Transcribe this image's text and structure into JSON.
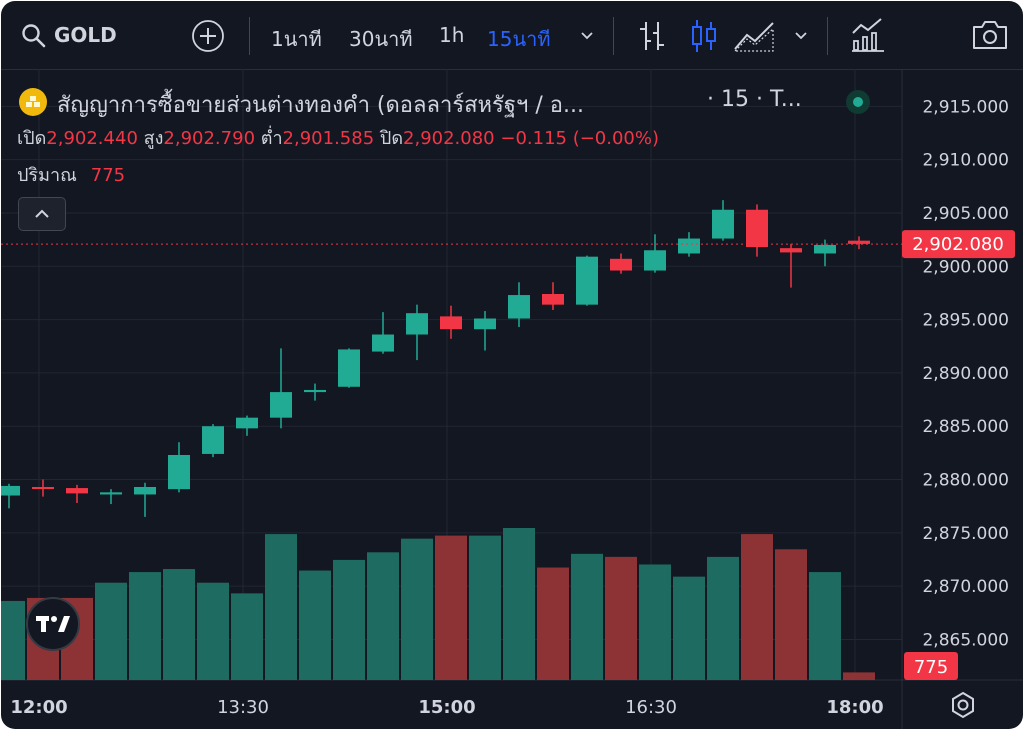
{
  "toolbar": {
    "symbol": "GOLD",
    "intervals": [
      "1นาที",
      "30นาที",
      "1h",
      "15นาที"
    ],
    "active_interval": "15นาที"
  },
  "legend": {
    "title": "สัญญาการซื้อขายส่วนต่างทองคำ (ดอลลาร์สหรัฐฯ / อ...",
    "interval": "· 15 · T...",
    "open_label": "เปิด",
    "open": "2,902.440",
    "high_label": "สูง",
    "high": "2,902.790",
    "low_label": "ต่ำ",
    "low": "2,901.585",
    "close_label": "ปิด",
    "close": "2,902.080",
    "change": "−0.115 (−0.00%)",
    "volume_label": "ปริมาณ",
    "volume": "775"
  },
  "colors": {
    "up": "#22ab94",
    "down": "#f23645",
    "vol_up": "#1e6b62",
    "vol_down": "#8d3335",
    "background": "#131722"
  },
  "chart_data": {
    "type": "candlestick",
    "x_ticks": [
      "12:00",
      "13:30",
      "15:00",
      "16:30",
      "18:00"
    ],
    "y_ticks": [
      "2,915.000",
      "2,910.000",
      "2,905.000",
      "2,900.000",
      "2,895.000",
      "2,890.000",
      "2,885.000",
      "2,880.000",
      "2,875.000",
      "2,870.000",
      "2,865.000"
    ],
    "ylim": [
      2861.2,
      2918.5
    ],
    "last_price": 2902.08,
    "last_price_label": "2,902.080",
    "volume_label": "775",
    "candles": [
      {
        "o": 2878.5,
        "h": 2879.6,
        "l": 2877.3,
        "c": 2879.4
      },
      {
        "o": 2879.3,
        "h": 2880.0,
        "l": 2878.4,
        "c": 2879.2
      },
      {
        "o": 2879.2,
        "h": 2879.5,
        "l": 2877.8,
        "c": 2878.7
      },
      {
        "o": 2878.6,
        "h": 2879.1,
        "l": 2877.7,
        "c": 2878.8
      },
      {
        "o": 2878.6,
        "h": 2879.7,
        "l": 2876.5,
        "c": 2879.3
      },
      {
        "o": 2879.1,
        "h": 2883.5,
        "l": 2878.8,
        "c": 2882.3
      },
      {
        "o": 2882.4,
        "h": 2885.2,
        "l": 2882.1,
        "c": 2885.0
      },
      {
        "o": 2884.8,
        "h": 2886.0,
        "l": 2884.1,
        "c": 2885.8
      },
      {
        "o": 2885.8,
        "h": 2892.3,
        "l": 2884.8,
        "c": 2888.2
      },
      {
        "o": 2888.2,
        "h": 2889.0,
        "l": 2887.4,
        "c": 2888.4
      },
      {
        "o": 2888.7,
        "h": 2892.3,
        "l": 2888.6,
        "c": 2892.2
      },
      {
        "o": 2892.0,
        "h": 2895.7,
        "l": 2891.8,
        "c": 2893.6
      },
      {
        "o": 2893.6,
        "h": 2896.4,
        "l": 2891.2,
        "c": 2895.6
      },
      {
        "o": 2895.3,
        "h": 2896.3,
        "l": 2893.2,
        "c": 2894.1
      },
      {
        "o": 2894.1,
        "h": 2895.8,
        "l": 2892.1,
        "c": 2895.1
      },
      {
        "o": 2895.1,
        "h": 2898.5,
        "l": 2894.3,
        "c": 2897.3
      },
      {
        "o": 2897.4,
        "h": 2898.5,
        "l": 2895.9,
        "c": 2896.4
      },
      {
        "o": 2896.4,
        "h": 2901.0,
        "l": 2896.3,
        "c": 2900.9
      },
      {
        "o": 2900.7,
        "h": 2901.2,
        "l": 2899.3,
        "c": 2899.6
      },
      {
        "o": 2899.6,
        "h": 2903.0,
        "l": 2899.4,
        "c": 2901.5
      },
      {
        "o": 2901.2,
        "h": 2903.2,
        "l": 2900.9,
        "c": 2902.6
      },
      {
        "o": 2902.6,
        "h": 2906.2,
        "l": 2902.4,
        "c": 2905.3
      },
      {
        "o": 2905.3,
        "h": 2905.8,
        "l": 2900.9,
        "c": 2901.8
      },
      {
        "o": 2901.7,
        "h": 2902.1,
        "l": 2898.0,
        "c": 2901.3
      },
      {
        "o": 2901.2,
        "h": 2902.5,
        "l": 2900.0,
        "c": 2902.0
      },
      {
        "o": 2902.4,
        "h": 2902.8,
        "l": 2901.6,
        "c": 2902.1
      }
    ],
    "volume_heights": [
      0.52,
      0.54,
      0.54,
      0.64,
      0.71,
      0.73,
      0.64,
      0.57,
      0.96,
      0.72,
      0.79,
      0.84,
      0.93,
      0.95,
      0.95,
      1.0,
      0.74,
      0.83,
      0.81,
      0.76,
      0.68,
      0.81,
      0.96,
      0.86,
      0.71,
      0.05
    ]
  }
}
